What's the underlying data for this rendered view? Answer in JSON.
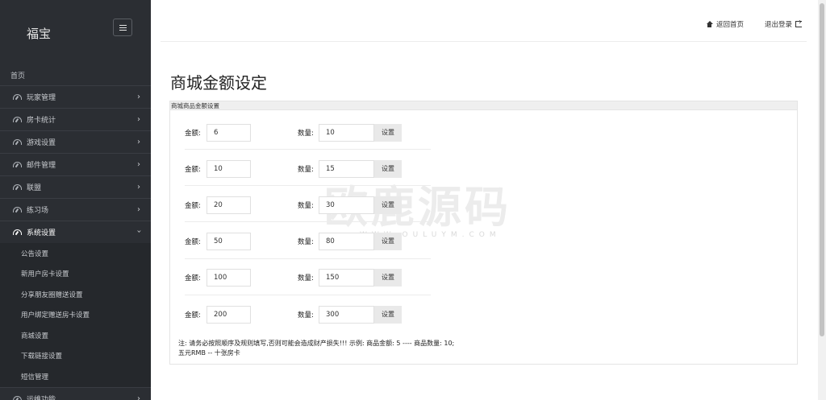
{
  "sidebar": {
    "brand": "福宝",
    "home": "首页",
    "items": [
      {
        "label": "玩家管理"
      },
      {
        "label": "房卡统计"
      },
      {
        "label": "游戏设置"
      },
      {
        "label": "邮件管理"
      },
      {
        "label": "联盟"
      },
      {
        "label": "练习场"
      },
      {
        "label": "系统设置"
      }
    ],
    "sub_items": [
      {
        "label": "公告设置"
      },
      {
        "label": "新用户房卡设置"
      },
      {
        "label": "分享朋友圈赠送设置"
      },
      {
        "label": "用户绑定赠送房卡设置"
      },
      {
        "label": "商城设置"
      },
      {
        "label": "下载链接设置"
      },
      {
        "label": "短信管理"
      }
    ],
    "last_item": {
      "label": "运维功能"
    }
  },
  "topbar": {
    "home_label": "返回首页",
    "logout_label": "退出登录"
  },
  "page": {
    "title": "商城金额设定",
    "panel_title": "商城商品金额设置",
    "amount_label": "金额:",
    "quantity_label": "数量:",
    "button_label": "设置",
    "rows": [
      {
        "amount": "6",
        "quantity": "10"
      },
      {
        "amount": "10",
        "quantity": "15"
      },
      {
        "amount": "20",
        "quantity": "30"
      },
      {
        "amount": "50",
        "quantity": "80"
      },
      {
        "amount": "100",
        "quantity": "150"
      },
      {
        "amount": "200",
        "quantity": "300"
      }
    ],
    "note_line1": "注: 请务必按照顺序及规则填写,否则可能会造成财产损失!!! 示例: 商品金额: 5 ---- 商品数量: 10;",
    "note_line2": "五元RMB -- 十张房卡"
  },
  "watermark": {
    "text": "欧鹿源码",
    "sub": "WWW.OULUYM.COM"
  }
}
